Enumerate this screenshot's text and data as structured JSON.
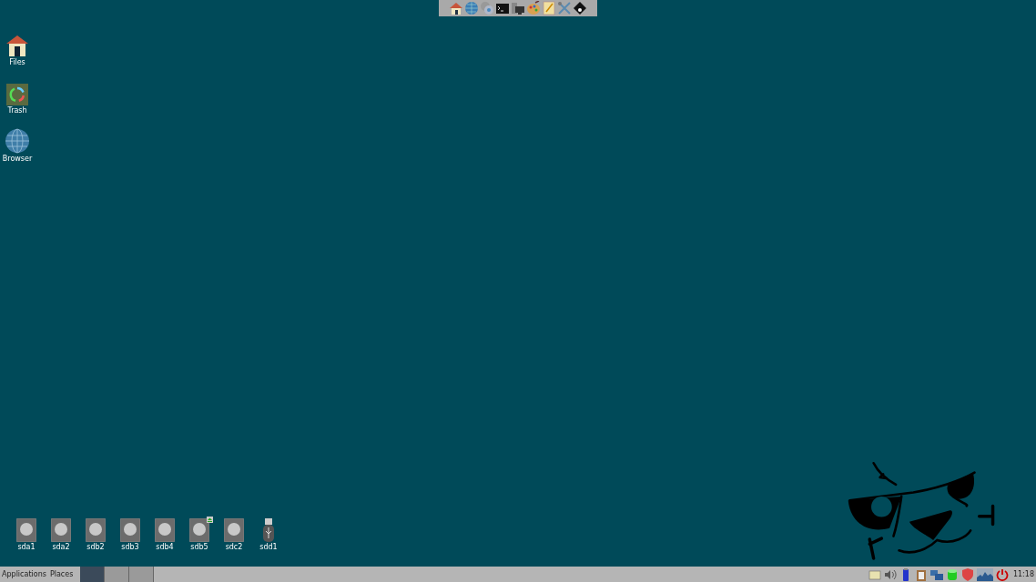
{
  "launcher_bar": {
    "items": [
      {
        "kind": "home"
      },
      {
        "kind": "globe"
      },
      {
        "kind": "chat"
      },
      {
        "kind": "terminal"
      },
      {
        "kind": "monitor"
      },
      {
        "kind": "palette"
      },
      {
        "kind": "notepad"
      },
      {
        "kind": "tools"
      },
      {
        "kind": "puppy"
      }
    ]
  },
  "desktop_icons": [
    {
      "label": "Files",
      "kind": "home"
    },
    {
      "label": "Trash",
      "kind": "trash"
    },
    {
      "label": "Browser",
      "kind": "globe"
    }
  ],
  "drives": [
    {
      "label": "sda1",
      "kind": "disk",
      "mounted": false
    },
    {
      "label": "sda2",
      "kind": "disk",
      "mounted": false
    },
    {
      "label": "sdb2",
      "kind": "disk",
      "mounted": false
    },
    {
      "label": "sdb3",
      "kind": "disk",
      "mounted": false
    },
    {
      "label": "sdb4",
      "kind": "disk",
      "mounted": false
    },
    {
      "label": "sdb5",
      "kind": "disk",
      "mounted": true
    },
    {
      "label": "sdc2",
      "kind": "disk",
      "mounted": false
    },
    {
      "label": "sdd1",
      "kind": "usb",
      "mounted": false
    }
  ],
  "taskbar": {
    "menus": [
      "Applications",
      "Places"
    ],
    "workspaces": [
      {
        "selected": true
      },
      {
        "selected": false
      },
      {
        "selected": false
      }
    ],
    "tray": [
      {
        "kind": "note"
      },
      {
        "kind": "volume"
      },
      {
        "kind": "battery"
      },
      {
        "kind": "clipboard"
      },
      {
        "kind": "network"
      },
      {
        "kind": "database"
      },
      {
        "kind": "shield"
      },
      {
        "kind": "monitor"
      },
      {
        "kind": "power"
      }
    ],
    "clock": "11:18"
  }
}
